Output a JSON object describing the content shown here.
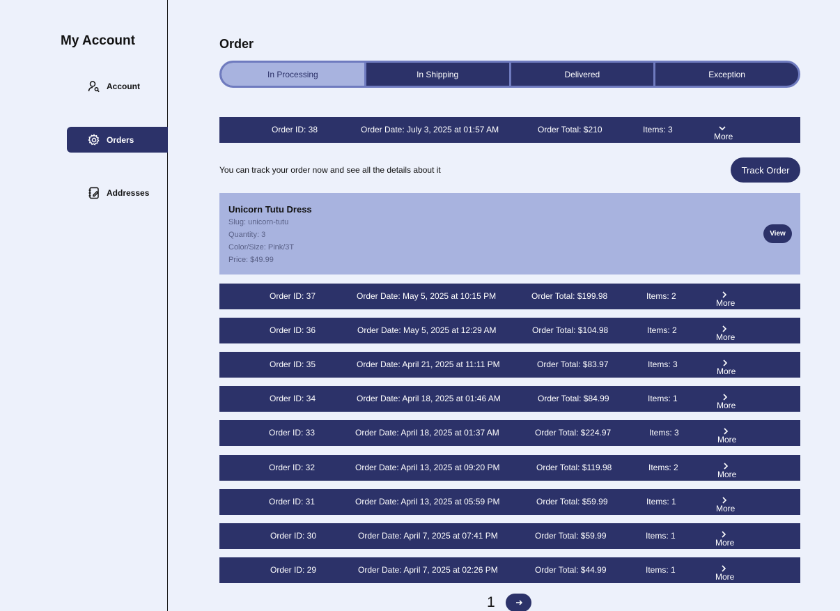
{
  "sidebar": {
    "title": "My Account",
    "items": [
      {
        "label": "Account",
        "icon": "user-search-icon",
        "active": false
      },
      {
        "label": "Orders",
        "icon": "gear-icon",
        "active": true
      },
      {
        "label": "Addresses",
        "icon": "address-book-icon",
        "active": false
      }
    ]
  },
  "main": {
    "title": "Order",
    "tabs": [
      {
        "label": "In Processing",
        "active": true
      },
      {
        "label": "In Shipping",
        "active": false
      },
      {
        "label": "Delivered",
        "active": false
      },
      {
        "label": "Exception",
        "active": false
      }
    ],
    "track": {
      "text": "You can track your order now and see all the details about it",
      "button": "Track Order"
    },
    "expanded_item": {
      "name": "Unicorn Tutu Dress",
      "slug": "Slug: unicorn-tutu",
      "quantity": "Quantity: 3",
      "color_size": "Color/Size: Pink/3T",
      "price": "Price: $49.99",
      "view_label": "View"
    },
    "more_label": "More",
    "orders": [
      {
        "id": "Order ID: 38",
        "date": "Order Date: July 3, 2025 at 01:57 AM",
        "total": "Order Total: $210",
        "items": "Items: 3",
        "expanded": true
      },
      {
        "id": "Order ID: 37",
        "date": "Order Date: May 5, 2025 at 10:15 PM",
        "total": "Order Total: $199.98",
        "items": "Items: 2"
      },
      {
        "id": "Order ID: 36",
        "date": "Order Date: May 5, 2025 at 12:29 AM",
        "total": "Order Total: $104.98",
        "items": "Items: 2"
      },
      {
        "id": "Order ID: 35",
        "date": "Order Date: April 21, 2025 at 11:11 PM",
        "total": "Order Total: $83.97",
        "items": "Items: 3"
      },
      {
        "id": "Order ID: 34",
        "date": "Order Date: April 18, 2025 at 01:46 AM",
        "total": "Order Total: $84.99",
        "items": "Items: 1"
      },
      {
        "id": "Order ID: 33",
        "date": "Order Date: April 18, 2025 at 01:37 AM",
        "total": "Order Total: $224.97",
        "items": "Items: 3"
      },
      {
        "id": "Order ID: 32",
        "date": "Order Date: April 13, 2025 at 09:20 PM",
        "total": "Order Total: $119.98",
        "items": "Items: 2"
      },
      {
        "id": "Order ID: 31",
        "date": "Order Date: April 13, 2025 at 05:59 PM",
        "total": "Order Total: $59.99",
        "items": "Items: 1"
      },
      {
        "id": "Order ID: 30",
        "date": "Order Date: April 7, 2025 at 07:41 PM",
        "total": "Order Total: $59.99",
        "items": "Items: 1"
      },
      {
        "id": "Order ID: 29",
        "date": "Order Date: April 7, 2025 at 02:26 PM",
        "total": "Order Total: $44.99",
        "items": "Items: 1"
      }
    ],
    "pagination": {
      "current_page": "1",
      "next_icon": "arrow-right-icon"
    }
  },
  "colors": {
    "background": "#edf1fb",
    "primary": "#2c3269",
    "active_tab": "#a8b3df",
    "tab_border": "#6f7bbf",
    "detail_text": "#5b6288"
  }
}
